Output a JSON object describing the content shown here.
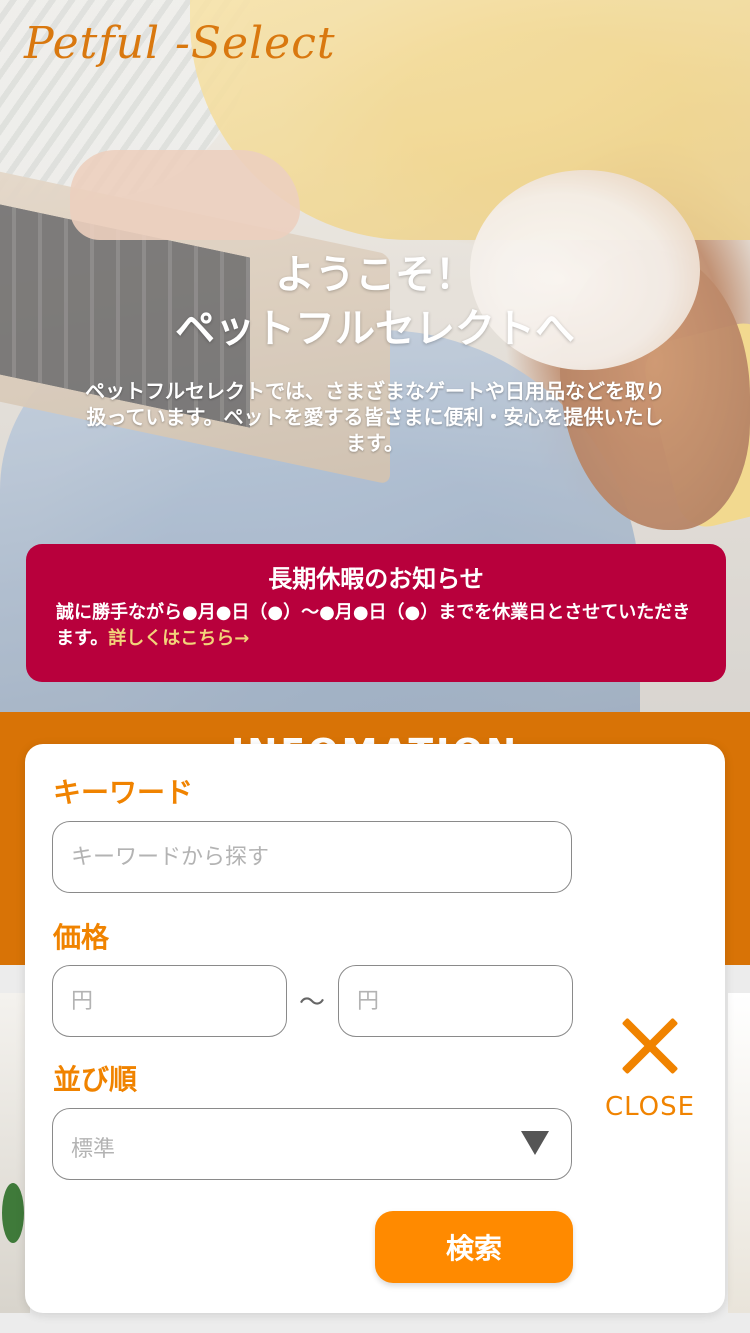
{
  "header": {
    "logo": "Petful -Select"
  },
  "hero": {
    "title_line1": "ようこそ！",
    "title_line2": "ペットフルセレクトへ",
    "description": "ペットフルセレクトでは、さまざまなゲートや日用品などを取り扱っています。ペットを愛する皆さまに便利・安心を提供いたします。"
  },
  "notice": {
    "title": "長期休暇のお知らせ",
    "body": "誠に勝手ながら●月●日（●）〜●月●日（●）までを休業日とさせていただきます。",
    "link": "詳しくはこちら→"
  },
  "info": {
    "heading": "INFOMATION"
  },
  "search_modal": {
    "keyword_label": "キーワード",
    "keyword_placeholder": "キーワードから探す",
    "price_label": "価格",
    "price_min_placeholder": "円",
    "price_separator": "〜",
    "price_max_placeholder": "円",
    "sort_label": "並び順",
    "sort_selected": "標準",
    "search_button": "検索",
    "close_label": "CLOSE"
  },
  "colors": {
    "accent": "#f08300",
    "button": "#ff8a00",
    "notice_bg": "#b8003c",
    "band_bg": "#d87306",
    "notice_link": "#f2d37a"
  },
  "icons": {
    "close": "close-icon",
    "dropdown": "chevron-down-icon"
  }
}
